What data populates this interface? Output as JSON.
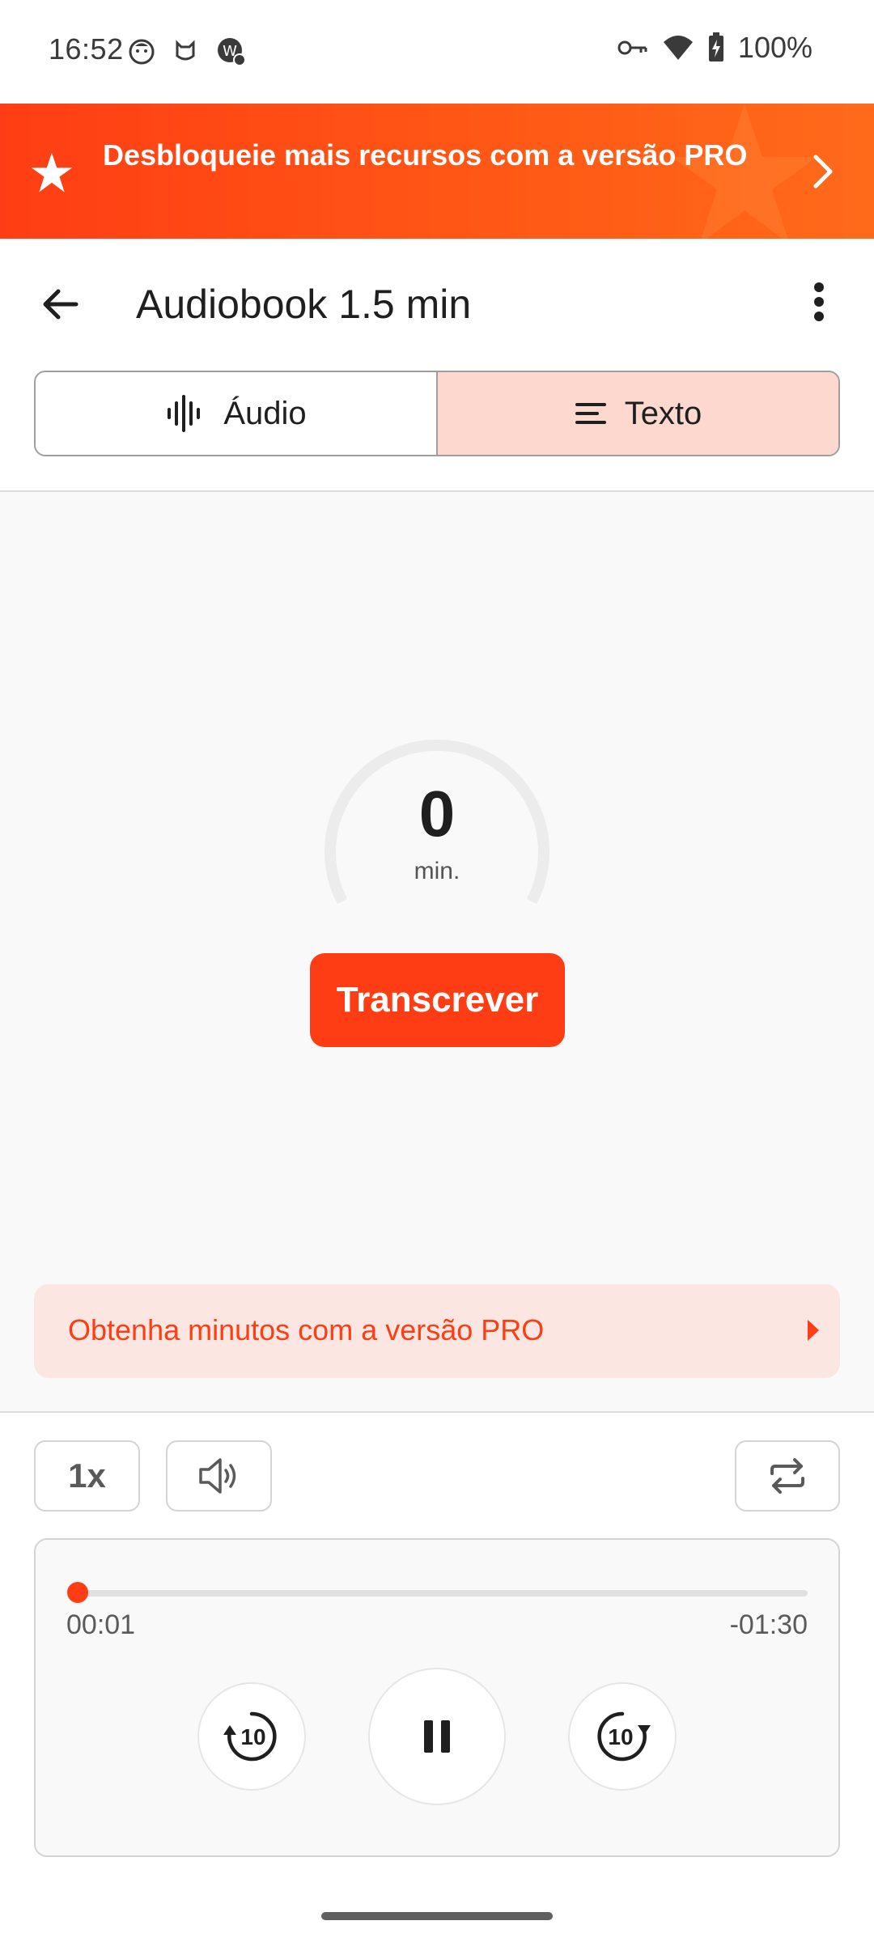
{
  "status_bar": {
    "time": "16:52",
    "battery": "100%"
  },
  "promo_banner": {
    "text": "Desbloqueie mais recursos com a versão PRO"
  },
  "app_bar": {
    "title": "Audiobook 1.5 min"
  },
  "tabs": [
    {
      "label": "Áudio",
      "icon": "waveform-icon",
      "selected": false
    },
    {
      "label": "Texto",
      "icon": "text-lines-icon",
      "selected": true
    }
  ],
  "transcription": {
    "minutes_value": "0",
    "minutes_unit": "min.",
    "button_label": "Transcrever"
  },
  "pro_minutes": {
    "text": "Obtenha minutos com a versão PRO"
  },
  "controls": {
    "speed": "1x",
    "volume_icon": "speaker-icon",
    "loop_icon": "repeat-icon"
  },
  "player": {
    "elapsed": "00:01",
    "remaining": "-01:30",
    "progress": 0.011,
    "rewind_label": "10",
    "forward_label": "10",
    "state": "playing"
  },
  "colors": {
    "accent": "#ff3d14",
    "selected_tab_bg": "#fdd8ce",
    "pro_bg": "#fce6e2"
  }
}
